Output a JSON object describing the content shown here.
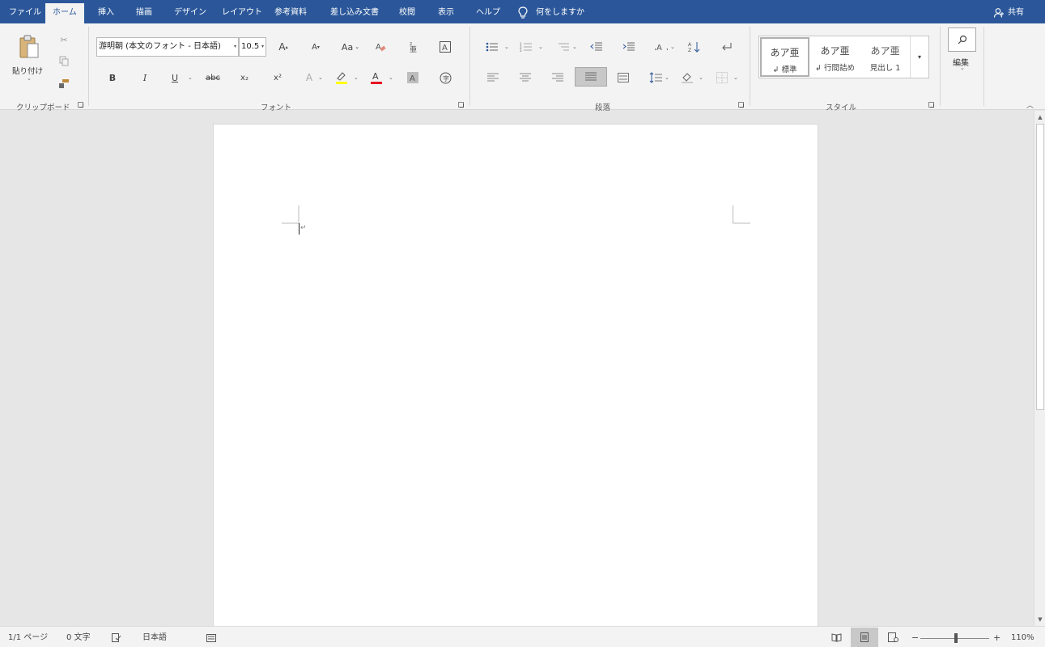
{
  "tabs": [
    "ファイル",
    "ホーム",
    "挿入",
    "描画",
    "デザイン",
    "レイアウト",
    "参考資料",
    "差し込み文書",
    "校閲",
    "表示",
    "ヘルプ"
  ],
  "active_tab": "ホーム",
  "tell_me": "何をしますか",
  "share": "共有",
  "clipboard": {
    "paste": "貼り付け",
    "group": "クリップボード"
  },
  "font": {
    "name": "游明朝 (本文のフォント - 日本語)",
    "size": "10.5",
    "group": "フォント",
    "change_case": "Aa",
    "bold": "B",
    "italic": "I",
    "underline": "U",
    "strike": "abc",
    "subscript": "x₂",
    "superscript": "x²",
    "grow": "A",
    "shrink": "A",
    "highlight_color": "#ffff00",
    "font_color": "#e81123"
  },
  "paragraph": {
    "group": "段落"
  },
  "styles": {
    "group": "スタイル",
    "items": [
      {
        "preview": "あア亜",
        "name": "↲ 標準"
      },
      {
        "preview": "あア亜",
        "name": "↲ 行間詰め"
      },
      {
        "preview": "あア亜",
        "name": "見出し 1"
      }
    ]
  },
  "editing": {
    "label": "編集"
  },
  "document": {
    "paragraph_mark": "↵"
  },
  "status": {
    "page": "1/1 ページ",
    "words": "0 文字",
    "language": "日本語",
    "zoom": "110%",
    "zoom_minus": "−",
    "zoom_plus": "+"
  },
  "colors": {
    "accent": "#2b579a",
    "ribbon_bg": "#f3f3f3",
    "workspace_bg": "#e6e6e6"
  }
}
